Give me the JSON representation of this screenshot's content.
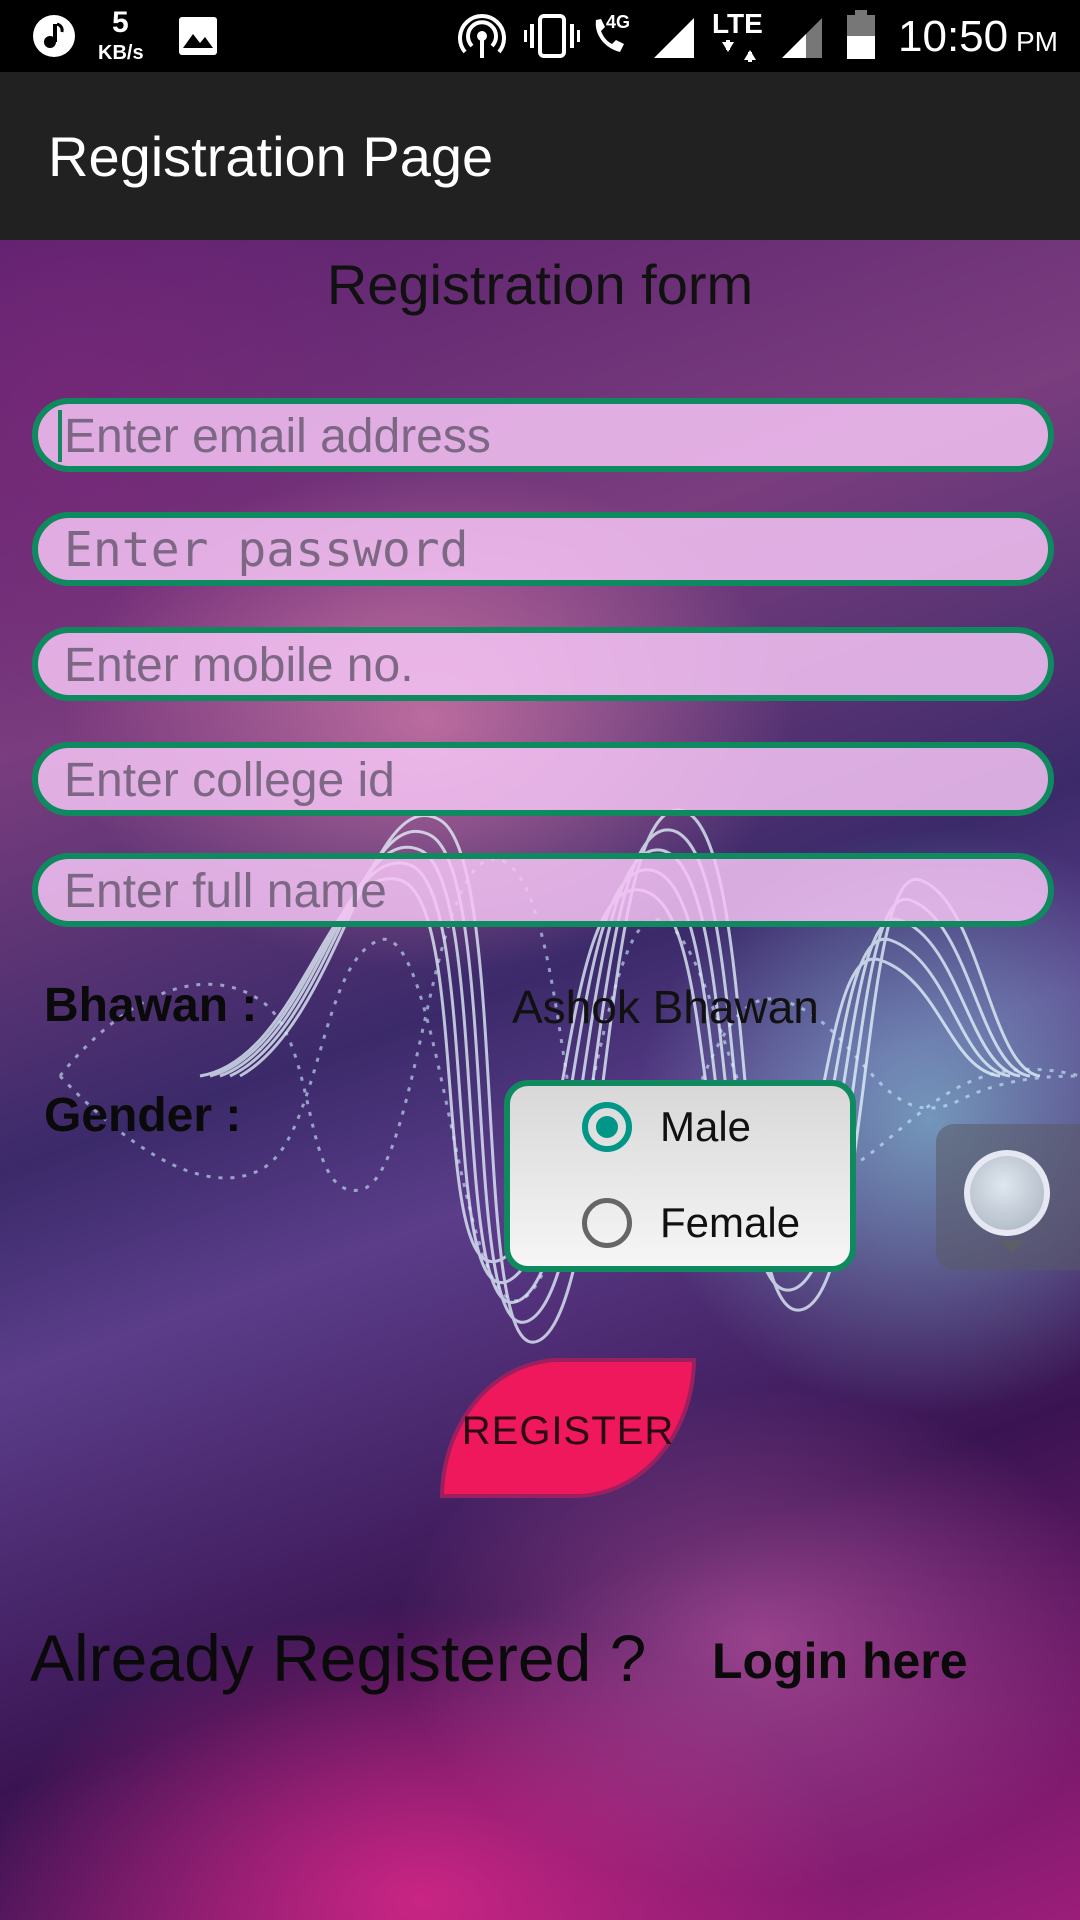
{
  "status_bar": {
    "net_speed_value": "5",
    "net_speed_unit": "KB/s",
    "network_type": "4G",
    "lte_label": "LTE",
    "time": "10:50",
    "am_pm": "PM"
  },
  "app_bar": {
    "title": "Registration Page"
  },
  "form": {
    "title": "Registration form",
    "email_placeholder": "Enter email address",
    "password_placeholder": "Enter password",
    "mobile_placeholder": "Enter mobile no.",
    "college_id_placeholder": "Enter college id",
    "full_name_placeholder": "Enter full name",
    "bhawan_label": "Bhawan :",
    "bhawan_value": "Ashok Bhawan",
    "gender_label": "Gender :",
    "gender_options": [
      {
        "label": "Male",
        "selected": true
      },
      {
        "label": "Female",
        "selected": false
      }
    ],
    "register_label": "REGISTER"
  },
  "footer": {
    "already_registered": "Already Registered ?",
    "login_link": "Login here"
  },
  "colors": {
    "field_border": "#0f8a5e",
    "register_button": "#f0185c",
    "radio_selected": "#009688"
  }
}
